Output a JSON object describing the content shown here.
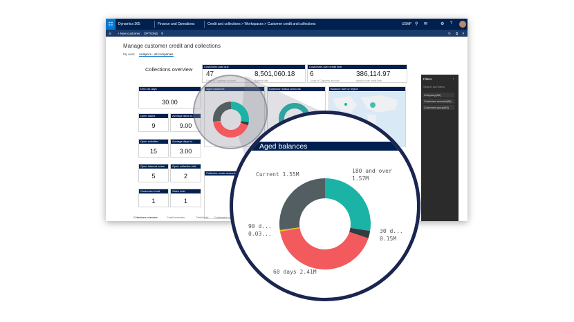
{
  "topbar": {
    "product": "Dynamics 365",
    "module": "Finance and Operations",
    "breadcrumb": "Credit and collections  >  Workspaces  >  Customer credit and collections",
    "company": "USMF"
  },
  "cmdbar": {
    "new_label": "+ New customer",
    "options_label": "OPTIONS"
  },
  "page": {
    "title": "Manage customer credit and collections",
    "tabs": [
      "My work",
      "Analytics - all companies"
    ],
    "workspace_title": "Collections overview"
  },
  "kpis": {
    "past_due": {
      "header": "Customers past due",
      "count": "47",
      "count_sub": "Count of Customer account",
      "amount": "8,501,060.18",
      "amount_sub": "Balance due"
    },
    "over_limit": {
      "header": "Customers over credit limit",
      "count": "6",
      "count_sub": "Count of Customer account",
      "amount": "386,114.97",
      "amount_sub": "Amount over credit limit"
    }
  },
  "tiles": [
    {
      "label": "DSO 30 days",
      "value": "30.00"
    },
    {
      "label": "Open cases",
      "value": "9"
    },
    {
      "label": "Average days to...",
      "value": "9.00"
    },
    {
      "label": "Open activities",
      "value": "15"
    },
    {
      "label": "Average days to...",
      "value": "3.00"
    },
    {
      "label": "Open interest notes",
      "value": "5"
    },
    {
      "label": "Open collection lett...",
      "value": "2"
    },
    {
      "label": "Customers hold",
      "value": "1"
    },
    {
      "label": "Sales hold",
      "value": "1"
    }
  ],
  "charts": {
    "aged_small": "Aged balances",
    "collection_status": "Collection status amounts",
    "balance_region": "Balance due by region",
    "collection_code": "Collection code amounts"
  },
  "filters": {
    "title": "Filters",
    "hint": "Search and filters",
    "items": [
      "Company(All)",
      "Customer account(All)",
      "Customer group(All)"
    ]
  },
  "footer_tabs": [
    "Collections overview",
    "Credit overview",
    "Credit hold",
    "Customers over..."
  ],
  "lens": {
    "title": "Aged balances",
    "labels": {
      "current": "Current 1.55M",
      "over180_a": "180 and over",
      "over180_b": "1.57M",
      "d30_a": "30 d...",
      "d30_b": "0.15M",
      "d90_a": "90 d...",
      "d90_b": "0.03...",
      "d60": "60 days 2.41M"
    }
  },
  "chart_data": {
    "type": "pie",
    "title": "Aged balances",
    "categories": [
      "Current",
      "180 and over",
      "30 days",
      "60 days",
      "90 days"
    ],
    "values": [
      1.55,
      1.57,
      0.15,
      2.41,
      0.03
    ],
    "unit": "M",
    "colors": [
      "#525e61",
      "#1ab3a6",
      "#333d40",
      "#f25a5e",
      "#e8c020"
    ]
  }
}
